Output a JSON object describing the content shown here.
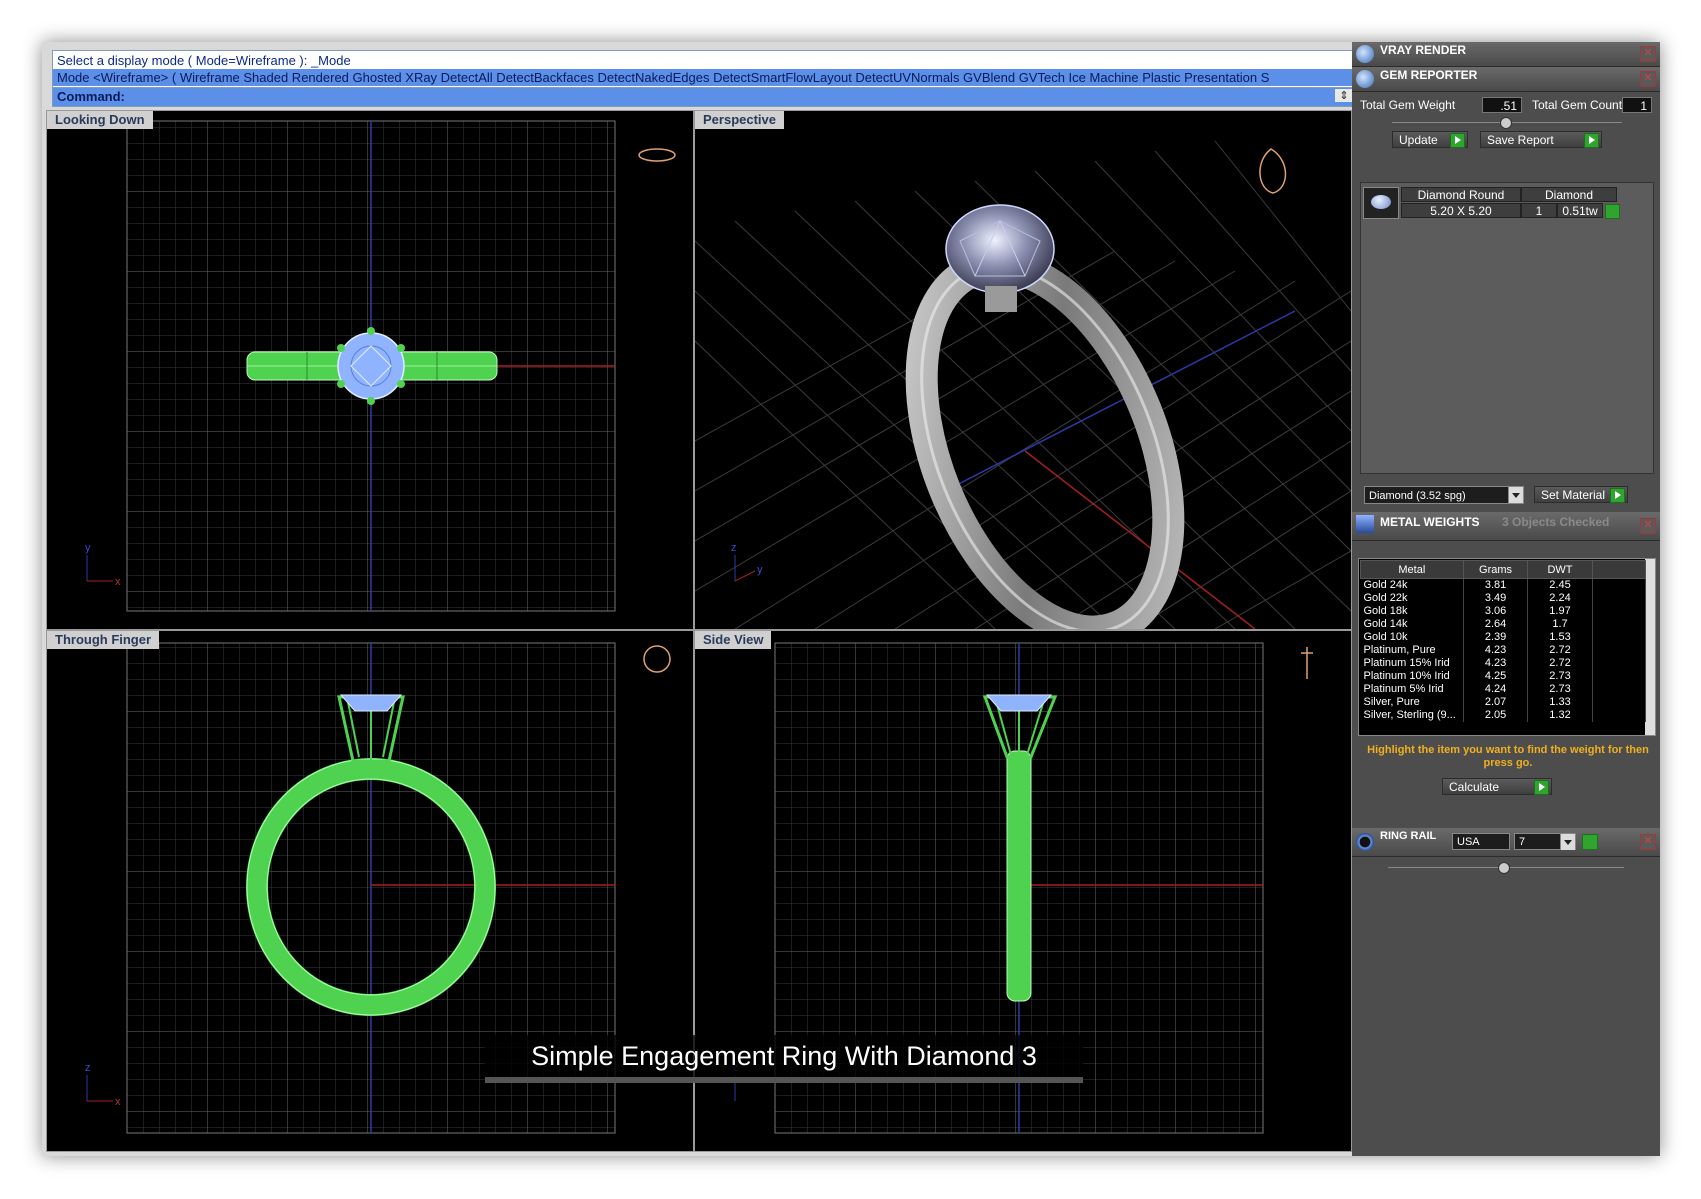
{
  "command": {
    "history": [
      "Select a display mode ( Mode=Wireframe ): _Mode",
      "Mode <Wireframe> ( Wireframe  Shaded  Rendered  Ghosted  XRay  DetectAll  DetectBackfaces  DetectNakedEdges  DetectSmartFlowLayout  DetectUVNormals  GVBlend  GVTech  Ice  Machine  Plastic  Presentation  S"
    ],
    "prompt": "Command:"
  },
  "viewports": {
    "top_left": "Looking Down",
    "top_right": "Perspective",
    "bottom_left": "Through Finger",
    "bottom_right": "Side View"
  },
  "axis_labels": {
    "x": "x",
    "y": "y",
    "z": "z"
  },
  "caption": "Simple Engagement Ring With Diamond 3",
  "panel": {
    "vray": {
      "title": "VRAY RENDER"
    },
    "gem": {
      "title": "GEM REPORTER",
      "total_weight_label": "Total Gem Weight",
      "total_weight": ".51",
      "total_count_label": "Total Gem Count",
      "total_count": "1",
      "update_label": "Update",
      "save_label": "Save Report",
      "row": {
        "type": "Diamond Round",
        "material": "Diamond",
        "size": "5.20 X 5.20",
        "count": "1",
        "weight": "0.51tw"
      },
      "material_select": "Diamond     (3.52 spg)",
      "set_material_label": "Set Material"
    },
    "metal": {
      "title": "METAL WEIGHTS",
      "status": "3 Objects Checked",
      "columns": [
        "Metal",
        "Grams",
        "DWT"
      ],
      "rows": [
        [
          "Gold 24k",
          "3.81",
          "2.45"
        ],
        [
          "Gold 22k",
          "3.49",
          "2.24"
        ],
        [
          "Gold 18k",
          "3.06",
          "1.97"
        ],
        [
          "Gold 14k",
          "2.64",
          "1.7"
        ],
        [
          "Gold 10k",
          "2.39",
          "1.53"
        ],
        [
          "Platinum, Pure",
          "4.23",
          "2.72"
        ],
        [
          "Platinum 15% Irid",
          "4.23",
          "2.72"
        ],
        [
          "Platinum 10% Irid",
          "4.25",
          "2.73"
        ],
        [
          "Platinum 5% Irid",
          "4.24",
          "2.73"
        ],
        [
          "Silver, Pure",
          "2.07",
          "1.33"
        ],
        [
          "Silver, Sterling (9...",
          "2.05",
          "1.32"
        ]
      ],
      "hint": "Highlight the item you want to find the weight for then press go.",
      "calculate_label": "Calculate"
    },
    "ring_rail": {
      "title": "RING RAIL",
      "region": "USA",
      "size": "7"
    }
  },
  "colors": {
    "command_highlight": "#5b8fe8",
    "wire_green": "#55e055",
    "gem_blue": "#8fb3ff",
    "hint_orange": "#f0b020",
    "go_green": "#2fa52f"
  }
}
